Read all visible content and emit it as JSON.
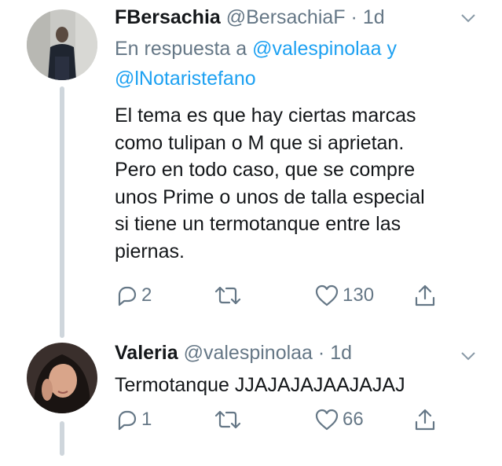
{
  "tweets": [
    {
      "name": "FBersachia",
      "handle": "@BersachiaF",
      "separator": "·",
      "time": "1d",
      "reply_prefix": "En respuesta a",
      "reply_mention_1": "@valespinolaa",
      "reply_joiner": "y",
      "reply_mention_2": "@lNotaristefano",
      "text": "El tema es que hay ciertas marcas\ncomo tulipan o M que si aprietan.\nPero en todo caso, que se compre\nunos Prime o unos de talla especial\nsi tiene un termotanque entre las\npiernas.",
      "replies": "2",
      "retweets": "",
      "likes": "130"
    },
    {
      "name": "Valeria",
      "handle": "@valespinolaa",
      "separator": "·",
      "time": "1d",
      "text": "Termotanque JJAJAJAJAAJAJAJ",
      "replies": "1",
      "retweets": "",
      "likes": "66"
    }
  ],
  "colors": {
    "accent": "#1da1f2",
    "secondary_text": "#657786",
    "primary_text": "#14171a",
    "thread_line": "#cfd6dc"
  },
  "icons": [
    "reply-icon",
    "retweet-icon",
    "like-icon",
    "share-icon",
    "chevron-down-icon"
  ]
}
